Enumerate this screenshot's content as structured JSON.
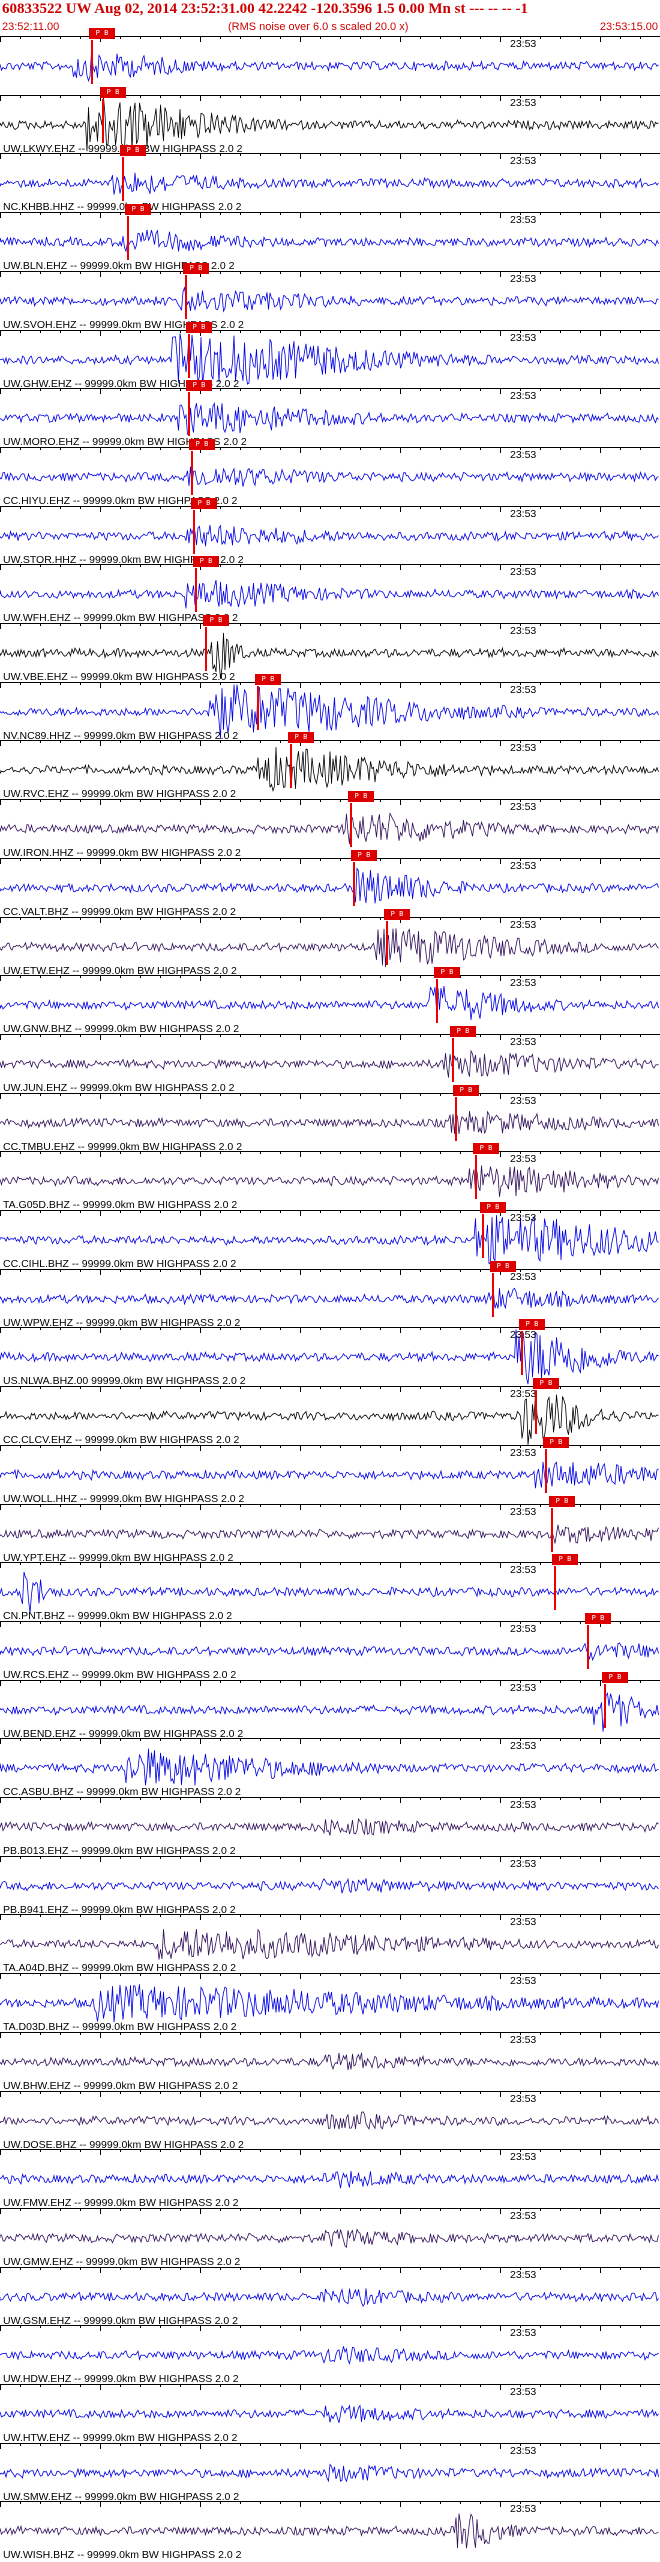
{
  "header": {
    "title": "60833522 UW Aug 02, 2014 23:52:31.00   42.2242 -120.3596  1.5 0.00 Mn st --- -- --  -1",
    "start_time": "23:52:11.00",
    "note": "(RMS noise over 6.0 s scaled 20.0 x)",
    "end_time": "23:53:15.00",
    "minute_label": "23:53",
    "pick_label": "P  B"
  },
  "colors": {
    "blue": "#0000e6",
    "black": "#000000",
    "purple": "#30105a",
    "pick": "#dd0000"
  },
  "traces": [
    {
      "label": "",
      "color": "blue",
      "pick": 0.138,
      "burst": [
        0.12,
        0.25,
        0.4
      ]
    },
    {
      "label": "UW.LKWY.EHZ -- 99999.0km BW  HIGHPASS  2.0  2",
      "color": "black",
      "pick": 0.155,
      "burst": [
        0.14,
        0.3,
        1.0
      ]
    },
    {
      "label": "NC.KHBB.HHZ -- 99999.0km BW  HIGHPASS  2.0  2",
      "color": "blue",
      "pick": 0.185,
      "burst": [
        0.18,
        0.25,
        0.3
      ]
    },
    {
      "label": "UW.BLN.EHZ -- 99999.0km BW  HIGHPASS  2.0  2",
      "color": "blue",
      "pick": 0.193,
      "burst": [
        0.19,
        0.25,
        0.3
      ]
    },
    {
      "label": "UW.SVOH.EHZ -- 99999.0km BW  HIGHPASS  2.0  2",
      "color": "blue",
      "pick": 0.28,
      "burst": [
        0.28,
        0.3,
        0.35
      ]
    },
    {
      "label": "UW.GHW.EHZ -- 99999.0km BW  HIGHPASS  2.0  2",
      "color": "blue",
      "pick": 0.285,
      "burst": [
        0.27,
        0.48,
        0.9
      ]
    },
    {
      "label": "UW.MORO.EHZ -- 99999.0km BW  HIGHPASS  2.0  2",
      "color": "blue",
      "pick": 0.285,
      "burst": [
        0.28,
        0.35,
        0.5
      ]
    },
    {
      "label": "CC.HIYU.EHZ -- 99999.0km BW  HIGHPASS  2.0  2",
      "color": "blue",
      "pick": 0.29,
      "burst": [
        0.29,
        0.3,
        0.3
      ]
    },
    {
      "label": "UW.STOR.HHZ -- 99999.0km BW  HIGHPASS  2.0  2",
      "color": "blue",
      "pick": 0.293,
      "burst": [
        0.29,
        0.3,
        0.3
      ]
    },
    {
      "label": "UW.WFH.EHZ -- 99999.0km BW  HIGHPASS  2.0  2",
      "color": "blue",
      "pick": 0.296,
      "burst": [
        0.29,
        0.3,
        0.4
      ]
    },
    {
      "label": "UW.VBE.EHZ -- 99999.0km BW  HIGHPASS  2.0  2",
      "color": "black",
      "pick": 0.31,
      "burst": [
        0.33,
        0.05,
        0.9
      ]
    },
    {
      "label": "NV.NC89.HHZ -- 99999.0km BW  HIGHPASS  2.0  2",
      "color": "blue",
      "pick": 0.39,
      "burst": [
        0.32,
        0.5,
        0.9
      ]
    },
    {
      "label": "UW.RVC.EHZ -- 99999.0km BW  HIGHPASS  2.0  2",
      "color": "black",
      "pick": 0.44,
      "burst": [
        0.4,
        0.35,
        0.7
      ]
    },
    {
      "label": "UW.IRON.HHZ -- 99999.0km BW  HIGHPASS  2.0  2",
      "color": "purple",
      "pick": 0.53,
      "burst": [
        0.53,
        0.3,
        0.5
      ]
    },
    {
      "label": "CC.VALT.BHZ -- 99999.0km BW  HIGHPASS  2.0  2",
      "color": "blue",
      "pick": 0.535,
      "burst": [
        0.54,
        0.2,
        0.6
      ]
    },
    {
      "label": "UW.ETW.EHZ -- 99999.0km BW  HIGHPASS  2.0  2",
      "color": "purple",
      "pick": 0.585,
      "burst": [
        0.58,
        0.35,
        0.6
      ]
    },
    {
      "label": "UW.GNW.BHZ -- 99999.0km BW  HIGHPASS  2.0  2",
      "color": "blue",
      "pick": 0.66,
      "burst": [
        0.66,
        0.2,
        0.6
      ]
    },
    {
      "label": "UW.JUN.EHZ -- 99999.0km BW  HIGHPASS  2.0  2",
      "color": "purple",
      "pick": 0.685,
      "burst": [
        0.68,
        0.3,
        0.4
      ]
    },
    {
      "label": "CC.TMBU.EHZ -- 99999.0km BW  HIGHPASS  2.0  2",
      "color": "purple",
      "pick": 0.69,
      "burst": [
        0.69,
        0.3,
        0.3
      ]
    },
    {
      "label": "TA.G05D.BHZ -- 99999.0km BW  HIGHPASS  2.0  2",
      "color": "purple",
      "pick": 0.72,
      "burst": [
        0.72,
        0.3,
        0.5
      ]
    },
    {
      "label": "CC.CIHL.BHZ -- 99999.0km BW  HIGHPASS  2.0  2",
      "color": "blue",
      "pick": 0.73,
      "burst": [
        0.73,
        0.45,
        0.8
      ]
    },
    {
      "label": "UW.WPW.EHZ -- 99999.0km BW  HIGHPASS  2.0  2",
      "color": "blue",
      "pick": 0.745,
      "burst": [
        0.75,
        0.2,
        0.3
      ]
    },
    {
      "label": "US.NLWA.BHZ.00 99999.0km BW  HIGHPASS  2.0  2",
      "color": "blue",
      "pick": 0.79,
      "burst": [
        0.79,
        0.2,
        1.0
      ]
    },
    {
      "label": "CC.CLCV.EHZ -- 99999.0km BW  HIGHPASS  2.0  2",
      "color": "black",
      "pick": 0.81,
      "burst": [
        0.8,
        0.15,
        1.0
      ]
    },
    {
      "label": "UW.WOLL.HHZ -- 99999.0km BW  HIGHPASS  2.0  2",
      "color": "blue",
      "pick": 0.825,
      "burst": [
        0.82,
        0.3,
        0.4
      ]
    },
    {
      "label": "UW.YPT.EHZ -- 99999.0km BW  HIGHPASS  2.0  2",
      "color": "purple",
      "pick": 0.835,
      "burst": [
        0.84,
        0.3,
        0.2
      ]
    },
    {
      "label": "CN.PNT.BHZ -- 99999.0km BW  HIGHPASS  2.0  2",
      "color": "blue",
      "pick": 0.84,
      "burst": [
        0.04,
        0.05,
        0.7
      ]
    },
    {
      "label": "UW.RCS.EHZ -- 99999.0km BW  HIGHPASS  2.0  2",
      "color": "blue",
      "pick": 0.89,
      "burst": [
        0.89,
        0.2,
        0.2
      ]
    },
    {
      "label": "UW.BEND.EHZ -- 99999.0km BW  HIGHPASS  2.0  2",
      "color": "blue",
      "pick": 0.915,
      "burst": [
        0.91,
        0.1,
        0.7
      ]
    },
    {
      "label": "CC.ASBU.BHZ -- 99999.0km BW  HIGHPASS  2.0  2",
      "color": "blue",
      "pick": null,
      "burst": [
        0.2,
        0.4,
        0.6
      ]
    },
    {
      "label": "PB.B013.EHZ -- 99999.0km BW  HIGHPASS  2.0  2",
      "color": "purple",
      "pick": null,
      "burst": [
        0.5,
        0.2,
        0.2
      ]
    },
    {
      "label": "PB.B941.EHZ -- 99999.0km BW  HIGHPASS  2.0  2",
      "color": "blue",
      "pick": null,
      "burst": [
        0.5,
        0.2,
        0.15
      ]
    },
    {
      "label": "TA.A04D.BHZ -- 99999.0km BW  HIGHPASS  2.0  2",
      "color": "purple",
      "pick": null,
      "burst": [
        0.25,
        0.6,
        0.5
      ]
    },
    {
      "label": "TA.D03D.BHZ -- 99999.0km BW  HIGHPASS  2.0  2",
      "color": "blue",
      "pick": null,
      "burst": [
        0.15,
        0.85,
        0.55
      ]
    },
    {
      "label": "UW.BHW.EHZ -- 99999.0km BW  HIGHPASS  2.0  2",
      "color": "purple",
      "pick": null,
      "burst": [
        0.5,
        0.2,
        0.2
      ]
    },
    {
      "label": "UW.DOSE.BHZ -- 99999.0km BW  HIGHPASS  2.0  2",
      "color": "purple",
      "pick": null,
      "burst": [
        0.5,
        0.2,
        0.2
      ]
    },
    {
      "label": "UW.FMW.EHZ -- 99999.0km BW  HIGHPASS  2.0  2",
      "color": "blue",
      "pick": null,
      "burst": [
        0.5,
        0.2,
        0.2
      ]
    },
    {
      "label": "UW.GMW.EHZ -- 99999.0km BW  HIGHPASS  2.0  2",
      "color": "purple",
      "pick": null,
      "burst": [
        0.5,
        0.2,
        0.2
      ]
    },
    {
      "label": "UW.GSM.EHZ -- 99999.0km BW  HIGHPASS  2.0  2",
      "color": "blue",
      "pick": null,
      "burst": [
        0.5,
        0.2,
        0.2
      ]
    },
    {
      "label": "UW.HDW.EHZ -- 99999.0km BW  HIGHPASS  2.0  2",
      "color": "blue",
      "pick": null,
      "burst": [
        0.5,
        0.2,
        0.2
      ]
    },
    {
      "label": "UW.HTW.EHZ -- 99999.0km BW  HIGHPASS  2.0  2",
      "color": "blue",
      "pick": null,
      "burst": [
        0.5,
        0.2,
        0.2
      ]
    },
    {
      "label": "UW.SMW.EHZ -- 99999.0km BW  HIGHPASS  2.0  2",
      "color": "blue",
      "pick": null,
      "burst": [
        0.5,
        0.2,
        0.2
      ]
    },
    {
      "label": "UW.WISH.BHZ -- 99999.0km BW  HIGHPASS  2.0  2",
      "color": "purple",
      "pick": null,
      "burst": [
        0.7,
        0.1,
        0.6
      ]
    }
  ]
}
